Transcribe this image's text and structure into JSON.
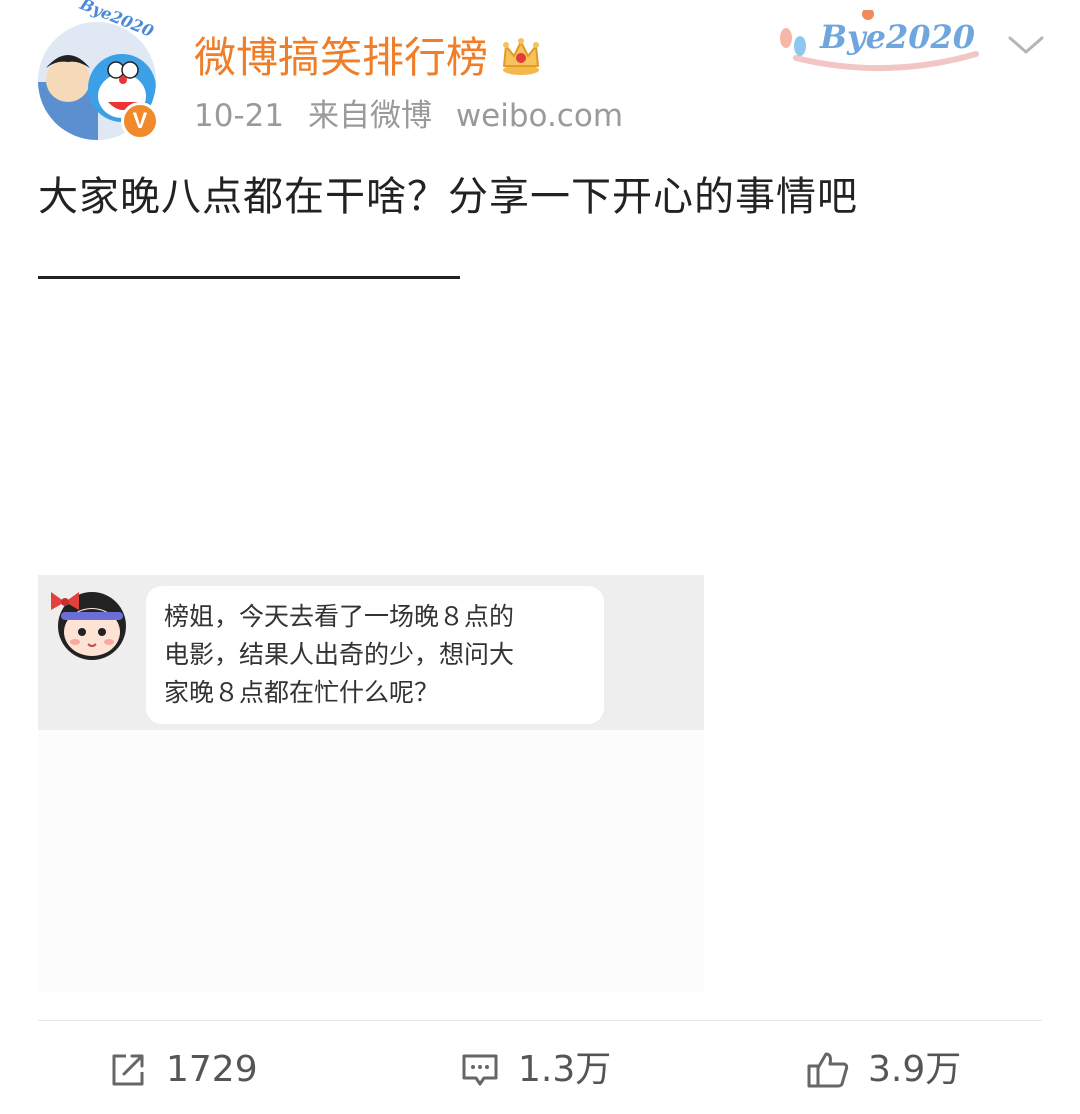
{
  "header": {
    "username": "微博搞笑排行榜",
    "avatar_badge_text": "Bye2020",
    "date": "10-21",
    "source_label": "来自微博",
    "source_site": "weibo.com",
    "verified_mark": "V",
    "top_badge_text": "Bye2020"
  },
  "post": {
    "text": "大家晚八点都在干啥？分享一下开心的事情吧"
  },
  "embed": {
    "bubble_lines": [
      "榜姐，今天去看了一场晚８点的",
      "电影，结果人出奇的少，想问大",
      "家晚８点都在忙什么呢？"
    ]
  },
  "actions": {
    "repost_count": "1729",
    "comment_count": "1.3万",
    "like_count": "3.9万"
  },
  "colors": {
    "username": "#f07d27",
    "verified": "#f08a2b",
    "meta": "#9a9a9a",
    "embed_bg": "#eeeeee"
  },
  "icons": {
    "avatar": "avatar-image",
    "crown": "crown-icon",
    "chevron": "chevron-down-icon",
    "repost": "share-icon",
    "comment": "comment-icon",
    "like": "thumbs-up-icon"
  }
}
